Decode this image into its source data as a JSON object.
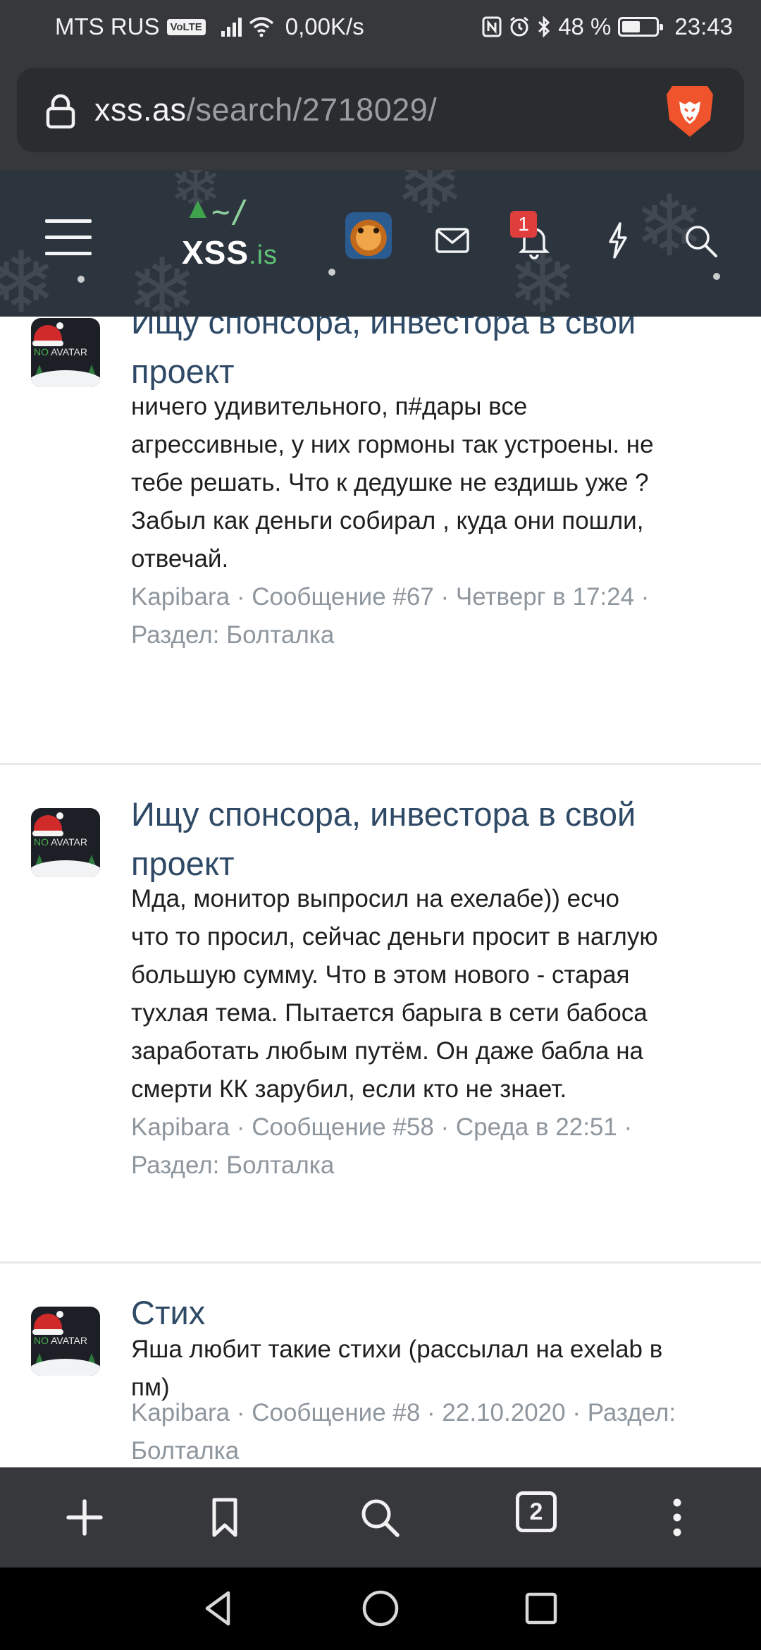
{
  "status_bar": {
    "carrier": "MTS RUS",
    "volte": "VoLTE",
    "speed": "0,00K/s",
    "battery": "48 %",
    "battery_level": 0.48,
    "time": "23:43"
  },
  "browser": {
    "url_host": "xss.as",
    "url_path": "/search/2718029/",
    "tabs_count": "2"
  },
  "site_header": {
    "logo_tilde": "~/",
    "logo_name": "XSS",
    "logo_tld": ".is",
    "notifications_count": "1"
  },
  "avatar_label": {
    "no": "NO",
    "avatar": "AVATAR"
  },
  "results": [
    {
      "title_line1": "Ищу спонсора, инвестора в свой",
      "title_line2": "проект",
      "snippet": [
        "ничего удивительного, п#дары все",
        "агрессивные, у них гормоны так устроены. не",
        "тебе решать. Что к дедушке не ездишь уже ?",
        "Забыл как деньги собирал , куда они пошли,",
        "отвечай."
      ],
      "meta_line1": "Kapibara · Сообщение #67 · Четверг в 17:24 ·",
      "meta_line2": "Раздел: Болталка"
    },
    {
      "title_line1": "Ищу спонсора, инвестора в свой",
      "title_line2": "проект",
      "snippet": [
        "Мда, монитор выпросил на ехелабе)) есчо",
        "что то просил, сейчас деньги просит в наглую",
        "большую сумму. Что в этом нового - старая",
        "тухлая тема. Пытается барыга в сети бабоса",
        "заработать любым путём. Он даже бабла на",
        "смерти КК зарубил, если кто не знает."
      ],
      "meta_line1": "Kapibara · Сообщение #58 · Среда в 22:51 ·",
      "meta_line2": "Раздел: Болталка"
    },
    {
      "title_line1": "Стих",
      "snippet": [
        "Яша любит такие стихи (рассылал на exelab в",
        "пм)"
      ],
      "meta_line1": "Kapibara · Сообщение #8 · 22.10.2020 · Раздел:",
      "meta_line2": "Болталка"
    }
  ],
  "icons": {
    "lock": "lock-icon",
    "brave": "brave-lion-icon",
    "menu": "hamburger-menu-icon",
    "mail": "envelope-icon",
    "bell": "bell-icon",
    "bolt": "lightning-icon",
    "search": "search-icon",
    "add": "plus-icon",
    "bookmark": "bookmark-icon",
    "more": "kebab-menu-icon"
  },
  "colors": {
    "header_bg": "#2c343e",
    "title_link": "#2f4a66",
    "meta_text": "#8e969e",
    "badge": "#e03d3d",
    "brave_orange": "#f0542c"
  }
}
